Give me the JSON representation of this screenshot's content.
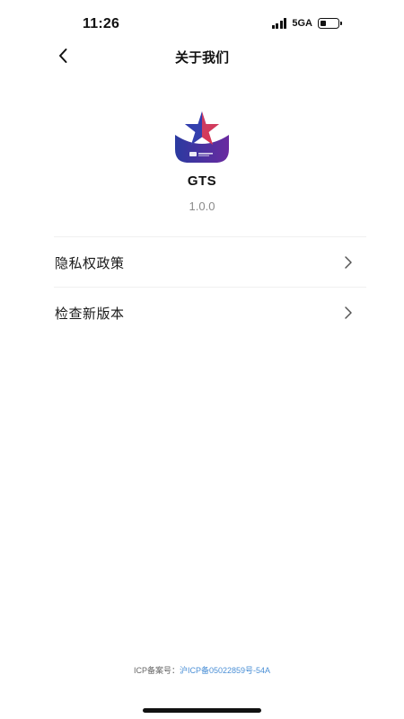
{
  "status_bar": {
    "time": "11:26",
    "network": "5GA",
    "battery_level": 0.3,
    "icons": [
      "signal-icon",
      "battery-icon"
    ]
  },
  "nav": {
    "title": "关于我们",
    "back_icon": "chevron-left-icon"
  },
  "app": {
    "name": "GTS",
    "version": "1.0.0",
    "logo": "app-logo",
    "logo_colors": {
      "star_blue": "#2f3aa8",
      "star_red": "#e0314a",
      "base_purple": "#5a2a9a",
      "base_blue": "#2a3aa0"
    }
  },
  "menu": {
    "items": [
      {
        "label": "隐私权政策",
        "icon": "chevron-right-icon"
      },
      {
        "label": "检查新版本",
        "icon": "chevron-right-icon"
      }
    ]
  },
  "footer": {
    "icp_label": "ICP备案号：",
    "icp_number": "沪ICP备05022859号-54A",
    "link_color": "#4a8fd6"
  }
}
